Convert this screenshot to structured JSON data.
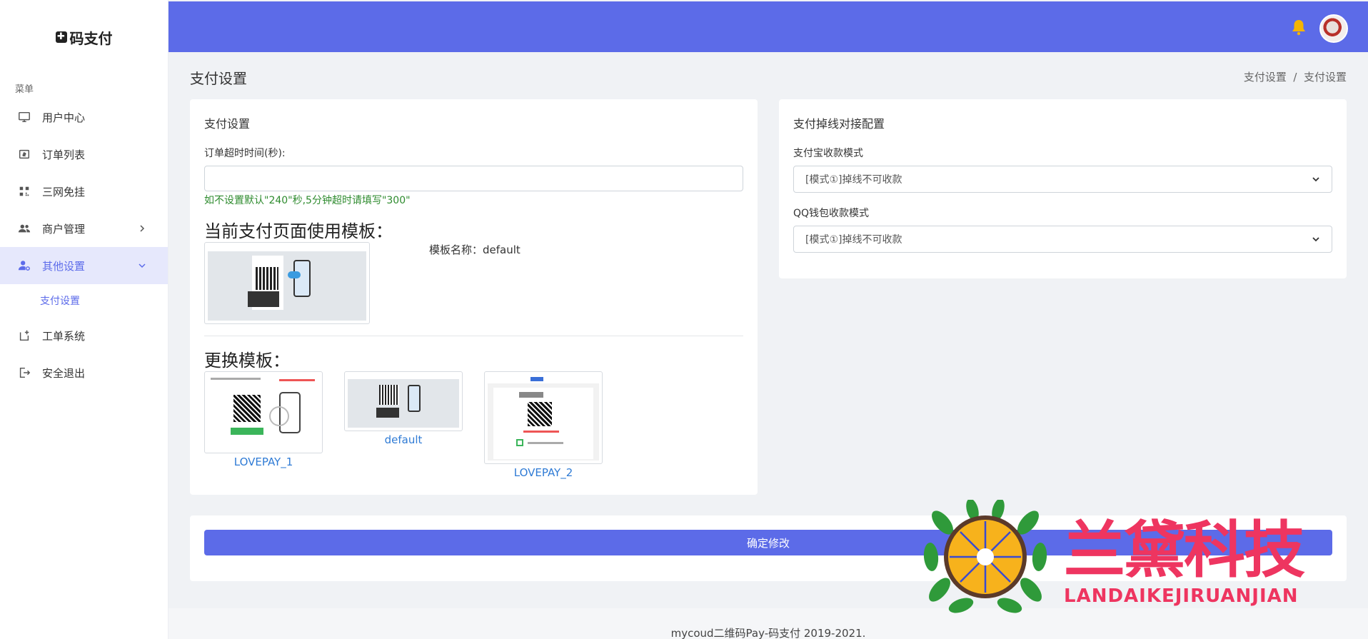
{
  "brand": {
    "name": "码支付"
  },
  "sidebar": {
    "caption": "菜单",
    "items": [
      {
        "label": "用户中心",
        "icon": "monitor-icon"
      },
      {
        "label": "订单列表",
        "icon": "receipt-icon"
      },
      {
        "label": "三网免挂",
        "icon": "qrcode-icon"
      },
      {
        "label": "商户管理",
        "icon": "users-icon"
      },
      {
        "label": "其他设置",
        "icon": "user-settings-icon"
      },
      {
        "label": "工单系统",
        "icon": "ticket-icon"
      },
      {
        "label": "安全退出",
        "icon": "logout-icon"
      }
    ],
    "sub_item": "支付设置"
  },
  "header": {
    "accent": "#5c6be8"
  },
  "page": {
    "title": "支付设置",
    "breadcrumb": "支付设置  /  支付设置"
  },
  "pay_settings": {
    "card_title": "支付设置",
    "timeout_label": "订单超时时间(秒):",
    "timeout_value": "",
    "hint": "如不设置默认\"240\"秒,5分钟超时请填写\"300\"",
    "current_template_heading": "当前支付页面使用模板：",
    "template_name": "模板名称：default",
    "change_template_heading": "更换模板：",
    "templates": [
      {
        "name": "LOVEPAY_1"
      },
      {
        "name": "default"
      },
      {
        "name": "LOVEPAY_2"
      }
    ]
  },
  "drop_config": {
    "card_title": "支付掉线对接配置",
    "alipay_label": "支付宝收款模式",
    "alipay_value": "[模式①]掉线不可收款",
    "qq_label": "QQ钱包收款模式",
    "qq_value": "[模式①]掉线不可收款"
  },
  "submit_label": "确定修改",
  "footer": "mycoud二维码Pay-码支付 2019-2021.",
  "watermark": {
    "title": "兰黛科技",
    "subtitle": "LANDAIKEJIRUANJIAN"
  }
}
